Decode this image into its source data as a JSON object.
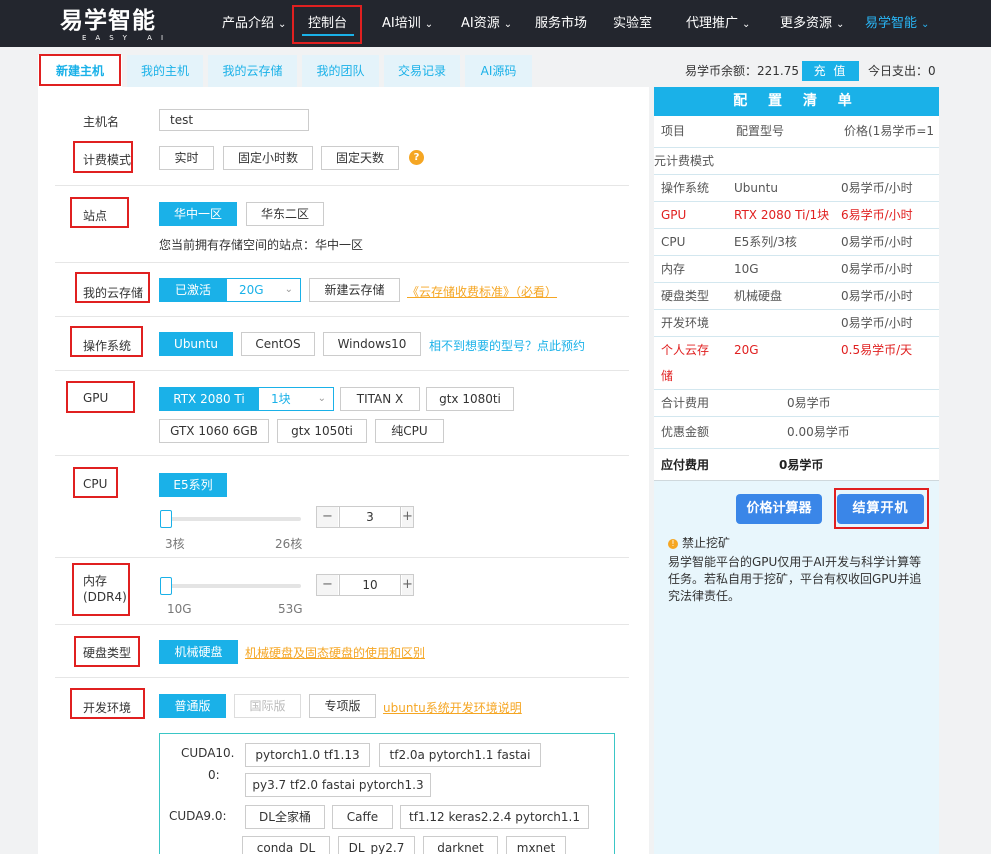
{
  "nav": {
    "logo": "易学智能",
    "logo_sub": "EASY AI",
    "items": [
      {
        "label": "产品介绍",
        "chev": "chevron-down-icon"
      },
      {
        "label": "控制台"
      },
      {
        "label": "AI培训",
        "chev": "chevron-down-icon"
      },
      {
        "label": "AI资源",
        "chev": "chevron-down-icon"
      },
      {
        "label": "服务市场"
      },
      {
        "label": "实验室"
      },
      {
        "label": "代理推广",
        "chev": "chevron-down-icon"
      },
      {
        "label": "更多资源",
        "chev": "chevron-down-icon"
      },
      {
        "label": "易学智能",
        "chev": "chevron-down-icon"
      }
    ],
    "accent": "#1ab1e8"
  },
  "tabs": [
    "新建主机",
    "我的主机",
    "我的云存储",
    "我的团队",
    "交易记录",
    "AI源码"
  ],
  "account": {
    "balance_label": "易学币余额：221.75",
    "recharge": "充 值",
    "spend_label": "今日支出：0"
  },
  "form": {
    "hostname": {
      "label": "主机名",
      "value": "test"
    },
    "billing": {
      "label": "计费模式",
      "options": [
        "实时",
        "固定小时数",
        "固定天数"
      ],
      "help": "?"
    },
    "site": {
      "label": "站点",
      "options": [
        "华中一区",
        "华东二区"
      ],
      "note": "您当前拥有存储空间的站点：华中一区"
    },
    "storage": {
      "label": "我的云存储",
      "activated": "已激活",
      "size": "20G",
      "new": "新建云存储",
      "link": "《云存储收费标准》（必看）"
    },
    "os": {
      "label": "操作系统",
      "options": [
        "Ubuntu",
        "CentOS",
        "Windows10"
      ],
      "link": "相不到想要的型号？点此预约"
    },
    "gpu": {
      "label": "GPU",
      "options": [
        "RTX 2080 Ti",
        "TITAN X",
        "gtx 1080ti",
        "GTX 1060 6GB",
        "gtx 1050ti",
        "纯CPU"
      ],
      "count": "1块"
    },
    "cpu": {
      "label": "CPU",
      "series": "E5系列",
      "min": "3核",
      "max": "26核",
      "value": "3",
      "level": 0
    },
    "memory": {
      "label": "内存",
      "label2": "(DDR4)",
      "min": "10G",
      "max": "53G",
      "value": "10",
      "level": 0
    },
    "disk": {
      "label": "硬盘类型",
      "option": "机械硬盘",
      "link": "机械硬盘及固态硬盘的使用和区别"
    },
    "env": {
      "label": "开发环境",
      "options": [
        "普通版",
        "国际版",
        "专项版"
      ],
      "link": "ubuntu系统开发环境说明",
      "cuda10_label": "CUDA10.",
      "cuda10_label2": "0:",
      "cuda10": [
        "pytorch1.0 tf1.13",
        "tf2.0a pytorch1.1 fastai",
        "py3.7 tf2.0 fastai pytorch1.3"
      ],
      "cuda9_label": "CUDA9.0:",
      "cuda9": [
        "DL全家桶",
        "Caffe",
        "tf1.12 keras2.2.4 pytorch1.1",
        "conda_DL",
        "DL_py2.7",
        "darknet",
        "mxnet"
      ]
    }
  },
  "summary": {
    "title": "配 置 清 单",
    "headers": [
      "项目",
      "配置型号",
      "价格(1易学币=1"
    ],
    "section": "元计费模式",
    "rows": [
      {
        "item": "操作系统",
        "model": "Ubuntu",
        "price": "0易学币/小时",
        "red": false
      },
      {
        "item": "GPU",
        "model": "RTX 2080 Ti/1块",
        "price": "6易学币/小时",
        "red": true
      },
      {
        "item": "CPU",
        "model": "E5系列/3核",
        "price": "0易学币/小时",
        "red": false
      },
      {
        "item": "内存",
        "model": "10G",
        "price": "0易学币/小时",
        "red": false
      },
      {
        "item": "硬盘类型",
        "model": "机械硬盘",
        "price": "0易学币/小时",
        "red": false
      },
      {
        "item": "开发环境",
        "model": "",
        "price": "0易学币/小时",
        "red": false
      }
    ],
    "storage_row": {
      "item": "个人云存",
      "item2": "储",
      "model": "20G",
      "price": "0.5易学币/天"
    },
    "total_label": "合计费用",
    "total_value": "0易学币",
    "discount_label": "优惠金额",
    "discount_value": "0.00易学币",
    "pay_label": "应付费用",
    "pay_value": "0易学币",
    "calc_btn": "价格计算器",
    "submit_btn": "结算开机",
    "warn_title": "禁止挖矿",
    "warn_text": "易学智能平台的GPU仅用于AI开发与科学计算等任务。若私自用于挖矿，平台有权收回GPU并追究法律责任。"
  }
}
